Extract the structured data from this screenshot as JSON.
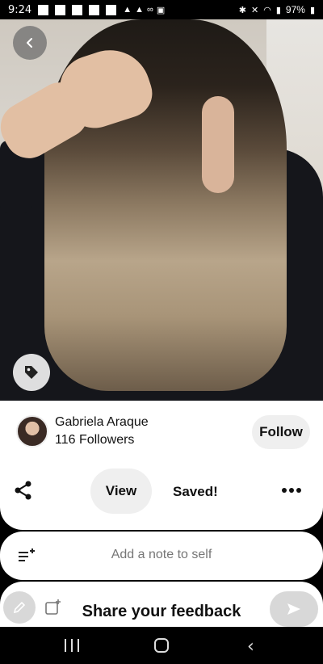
{
  "status_bar": {
    "time": "9:24",
    "battery": "97%"
  },
  "pin": {
    "creator": {
      "name": "Gabriela Araque",
      "followers": "116 Followers"
    },
    "follow_label": "Follow",
    "view_label": "View",
    "saved_label": "Saved!"
  },
  "note": {
    "placeholder": "Add a note to self"
  },
  "feedback": {
    "label": "Share your feedback"
  },
  "icons": {
    "back": "chevron-left-icon",
    "tag": "tag-icon",
    "share": "share-icon",
    "more": "more-icon",
    "note": "note-icon",
    "edit": "pencil-icon",
    "add_image": "add-image-icon",
    "send": "send-icon"
  }
}
